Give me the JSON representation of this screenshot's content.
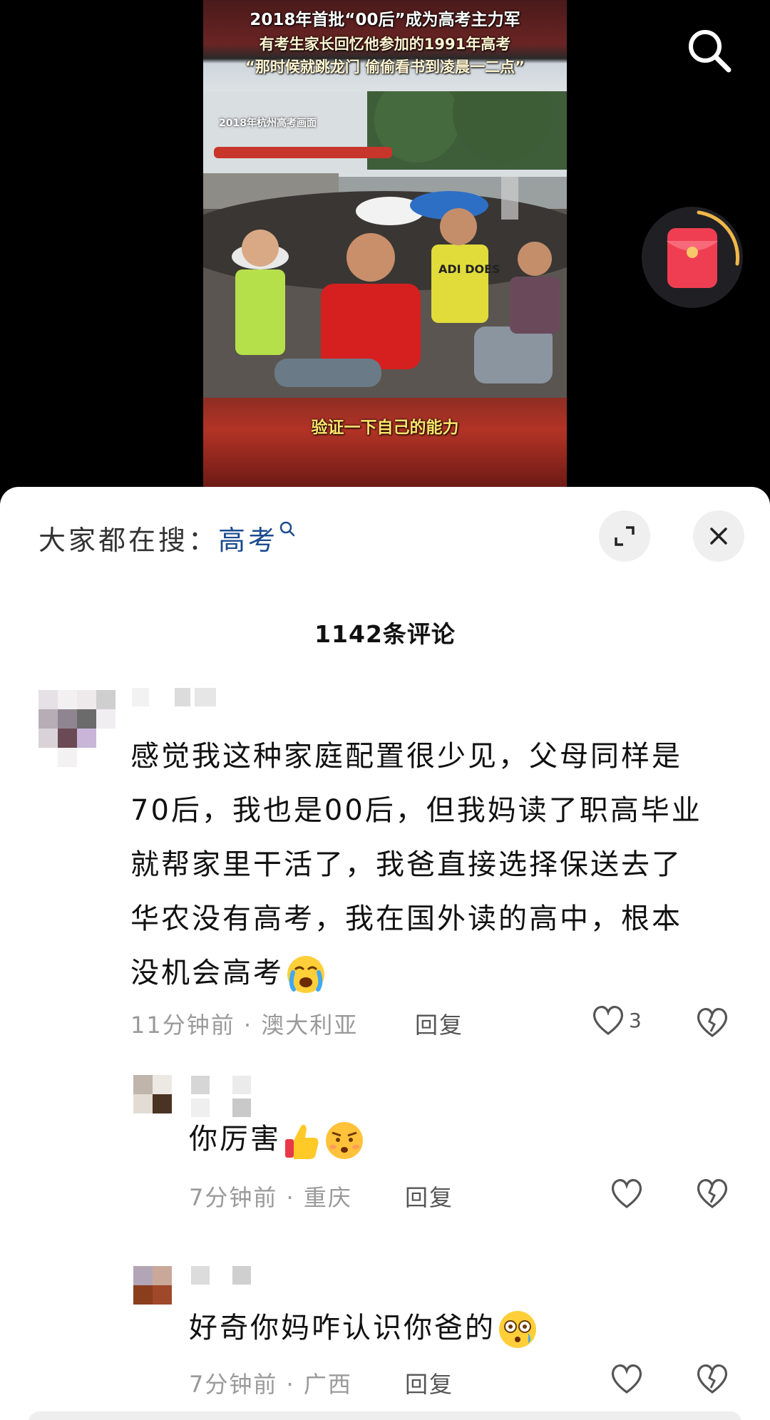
{
  "video": {
    "title_line1": "2018年首批“00后”成为高考主力军",
    "title_line2": "有考生家长回忆他参加的1991年高考",
    "title_line3": "“那时候就跳龙门 偷偷看书到凌晨一二点”",
    "location_caption": "2018年杭州高考画面",
    "subtitle": "验证一下自己的能力",
    "shirt_text": "ADI DOES"
  },
  "top_controls": {
    "search_icon": "search-icon",
    "redpacket_icon": "red-envelope-icon"
  },
  "panel": {
    "search_prompt_label": "大家都在搜：",
    "search_keyword": "高考",
    "comment_count_label": "1142条评论"
  },
  "comments": [
    {
      "lines": [
        "感觉我这种家庭配置很少见，父母同样是",
        "70后，我也是00后，但我妈读了职高毕业",
        "就帮家里干活了，我爸直接选择保送去了",
        "华农没有高考，我在国外读的高中，根本",
        "没机会高考"
      ],
      "emoji": "crying-face-emoji",
      "meta": "11分钟前 · 澳大利亚",
      "reply_label": "回复",
      "likes": "3"
    }
  ],
  "replies": [
    {
      "text": "你厉害",
      "emojis": [
        "thumbs-up-emoji",
        "frowning-face-emoji"
      ],
      "meta": "7分钟前 · 重庆",
      "reply_label": "回复"
    },
    {
      "text": "好奇你妈咋认识你爸的",
      "emojis": [
        "flushed-face-emoji"
      ],
      "meta": "7分钟前 · 广西",
      "reply_label": "回复"
    }
  ],
  "colors": {
    "keyword": "#1b4b8f",
    "caption_yellow": "#ffe36a",
    "redpacket": "#e8394a"
  }
}
